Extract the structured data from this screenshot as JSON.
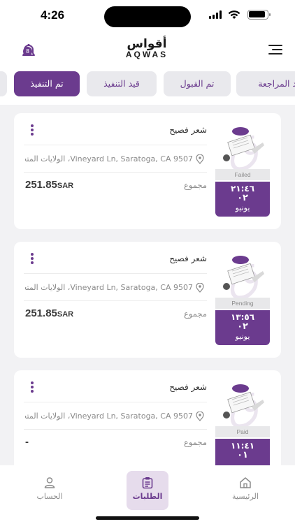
{
  "status_bar": {
    "time": "4:26"
  },
  "header": {
    "logo_ar": "أقواس",
    "logo_en": "AQWAS",
    "notification_count": "8",
    "notification_icon": "bell-icon",
    "menu_icon": "menu-icon"
  },
  "tabs": [
    {
      "label": "قيد المراجعة",
      "active": false
    },
    {
      "label": "تم القبول",
      "active": false
    },
    {
      "label": "قيد التنفيذ",
      "active": false
    },
    {
      "label": "تم التنفيذ",
      "active": true
    }
  ],
  "orders": [
    {
      "title": "شعر فصيح",
      "address": "Vineyard Ln, Saratoga, CA 9507، الولايات المتحدة",
      "total_label": "مجموع",
      "amount": "251.85",
      "currency": "SAR",
      "status": "Failed",
      "time": "٢١:٤٦",
      "day": "٠٢",
      "month": "يونيو"
    },
    {
      "title": "شعر فصيح",
      "address": "Vineyard Ln, Saratoga, CA 9507، الولايات المتحدة",
      "total_label": "مجموع",
      "amount": "251.85",
      "currency": "SAR",
      "status": "Pending",
      "time": "١٣:٥٦",
      "day": "٠٢",
      "month": "يونيو"
    },
    {
      "title": "شعر فصيح",
      "address": "Vineyard Ln, Saratoga, CA 9507، الولايات المتحدة",
      "total_label": "مجموع",
      "amount": "-",
      "currency": "",
      "status": "Paid",
      "time": "١١:٤١",
      "day": "٠١",
      "month": ""
    }
  ],
  "bottom_nav": [
    {
      "label": "الحساب",
      "icon": "user-icon",
      "active": false
    },
    {
      "label": "الطلبات",
      "icon": "clipboard-icon",
      "active": true
    },
    {
      "label": "الرئيسية",
      "icon": "home-icon",
      "active": false
    }
  ],
  "colors": {
    "accent": "#6b3b8e",
    "background": "#f2f2f4",
    "muted": "#8a8a8a"
  }
}
